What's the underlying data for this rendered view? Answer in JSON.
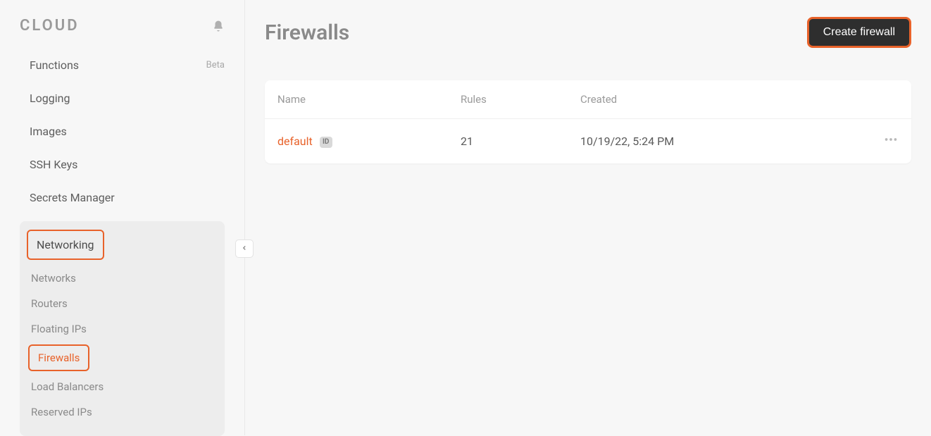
{
  "brand": "CLOUD",
  "sidebar": {
    "items": [
      {
        "label": "Functions",
        "badge": "Beta"
      },
      {
        "label": "Logging"
      },
      {
        "label": "Images"
      },
      {
        "label": "SSH Keys"
      },
      {
        "label": "Secrets Manager"
      }
    ],
    "group": {
      "header": "Networking",
      "items": [
        {
          "label": "Networks"
        },
        {
          "label": "Routers"
        },
        {
          "label": "Floating IPs"
        },
        {
          "label": "Firewalls",
          "active": true
        },
        {
          "label": "Load Balancers"
        },
        {
          "label": "Reserved IPs"
        }
      ]
    }
  },
  "page": {
    "title": "Firewalls",
    "create_button": "Create firewall"
  },
  "table": {
    "headers": {
      "name": "Name",
      "rules": "Rules",
      "created": "Created"
    },
    "rows": [
      {
        "name": "default",
        "id_badge": "ID",
        "rules": "21",
        "created": "10/19/22, 5:24 PM"
      }
    ]
  }
}
